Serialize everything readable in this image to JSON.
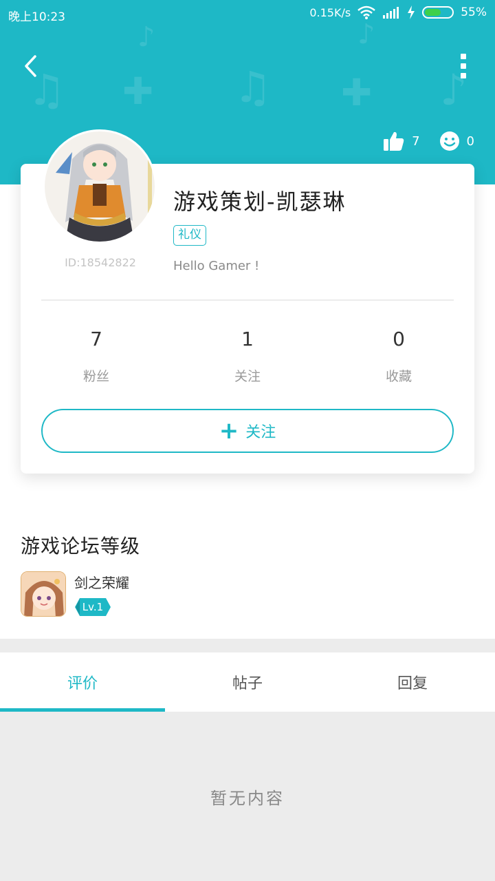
{
  "status_bar": {
    "time": "晚上10:23",
    "network_speed": "0.15K/s",
    "battery": "55%",
    "battery_level": 0.55
  },
  "header": {
    "likes_count": "7",
    "smiles_count": "0"
  },
  "profile": {
    "username": "游戏策划-凯瑟琳",
    "tag": "礼仪",
    "user_id": "ID:18542822",
    "bio": "Hello Gamer !",
    "counts": [
      {
        "value": "7",
        "label": "粉丝"
      },
      {
        "value": "1",
        "label": "关注"
      },
      {
        "value": "0",
        "label": "收藏"
      }
    ],
    "follow_button": "关注"
  },
  "forum_level": {
    "title": "游戏论坛等级",
    "game_name": "剑之荣耀",
    "level": "Lv.1"
  },
  "tabs": [
    {
      "label": "评价",
      "active": true
    },
    {
      "label": "帖子",
      "active": false
    },
    {
      "label": "回复",
      "active": false
    }
  ],
  "empty_text": "暂无内容",
  "colors": {
    "accent": "#1eb8c6",
    "tab_band": "#ececec"
  }
}
